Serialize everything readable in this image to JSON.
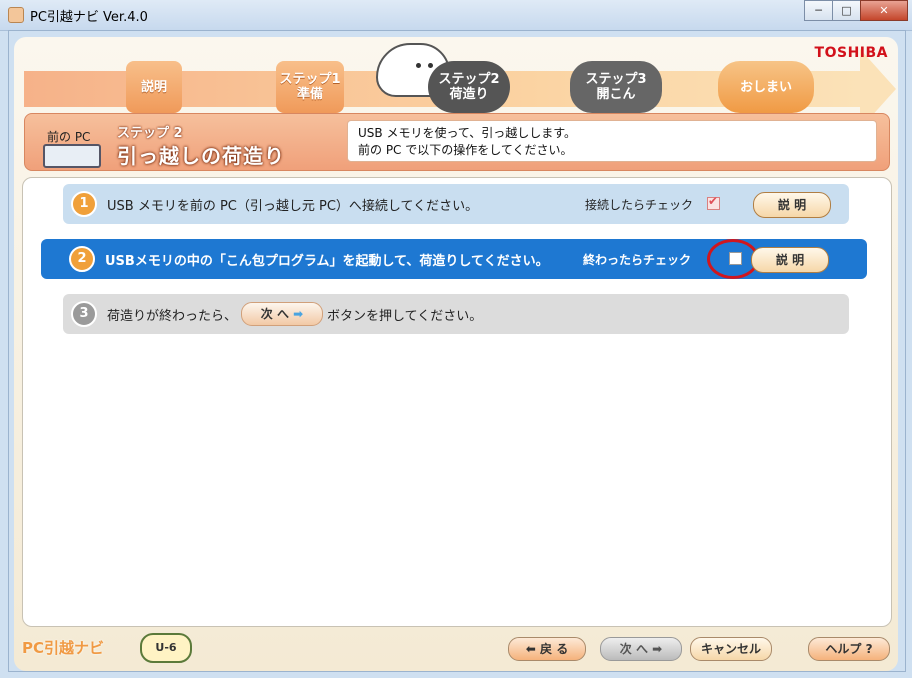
{
  "window": {
    "title": "PC引越ナビ Ver.4.0",
    "minimize": "─",
    "maximize": "□",
    "close": "✕"
  },
  "brand": "TOSHIBA",
  "progress": {
    "steps": [
      {
        "line1": "説明",
        "line2": "",
        "state": "done"
      },
      {
        "line1": "ステップ1",
        "line2": "準備",
        "state": "done"
      },
      {
        "line1": "ステップ2",
        "line2": "荷造り",
        "state": "current"
      },
      {
        "line1": "ステップ3",
        "line2": "開こん",
        "state": "future"
      },
      {
        "line1": "おしまい",
        "line2": "",
        "state": "final"
      }
    ]
  },
  "header": {
    "pc_label": "前の PC",
    "step_sub": "ステップ 2",
    "step_title": "引っ越しの荷造り",
    "message_line1": "USB メモリを使って、引っ越しします。",
    "message_line2": "前の PC で以下の操作をしてください。"
  },
  "tasks": [
    {
      "number": "1",
      "text": "USB メモリを前の PC（引っ越し元 PC）へ接続してください。",
      "check_label": "接続したらチェック",
      "checked": true,
      "explain_label": "説 明"
    },
    {
      "number": "2",
      "text": "USBメモリの中の「こん包プログラム」を起動して、荷造りしてください。",
      "check_label": "終わったらチェック",
      "checked": false,
      "explain_label": "説 明"
    },
    {
      "number": "3",
      "text_before": "荷造りが終わったら、",
      "inline_button": "次 へ",
      "text_after": "ボタンを押してください。"
    }
  ],
  "footer": {
    "logo": "PC引越ナビ",
    "badge": "U-6",
    "back": "戻 る",
    "next": "次 へ",
    "cancel": "キャンセル",
    "help": "ヘルプ ?"
  },
  "colors": {
    "accent_blue": "#1e78d2",
    "accent_orange": "#f09a44",
    "highlight_red": "#d0161e"
  }
}
